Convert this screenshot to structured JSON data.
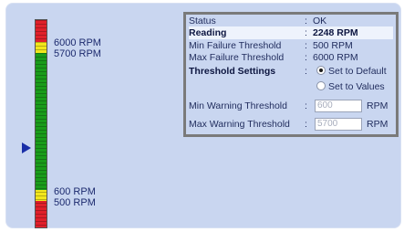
{
  "gauge": {
    "labels": {
      "max_failure": "6000 RPM",
      "max_warning": "5700 RPM",
      "min_warning": "600 RPM",
      "min_failure": "500 RPM"
    },
    "colors": {
      "failure": "#e0202a",
      "warning": "#f2e61c",
      "normal": "#1a9c1a",
      "pointer": "#1a2fa8"
    }
  },
  "info": {
    "separator": ":",
    "status": {
      "label": "Status",
      "value": "OK"
    },
    "reading": {
      "label": "Reading",
      "value": "2248 RPM"
    },
    "min_failure": {
      "label": "Min Failure Threshold",
      "value": "500 RPM"
    },
    "max_failure": {
      "label": "Max Failure Threshold",
      "value": "6000 RPM"
    },
    "threshold_settings": {
      "label": "Threshold Settings",
      "option_default": "Set to Default",
      "option_values": "Set to Values",
      "selected": "Set to Default"
    },
    "min_warning": {
      "label": "Min Warning Threshold",
      "value": "600",
      "unit": "RPM"
    },
    "max_warning": {
      "label": "Max Warning Threshold",
      "value": "5700",
      "unit": "RPM"
    }
  }
}
